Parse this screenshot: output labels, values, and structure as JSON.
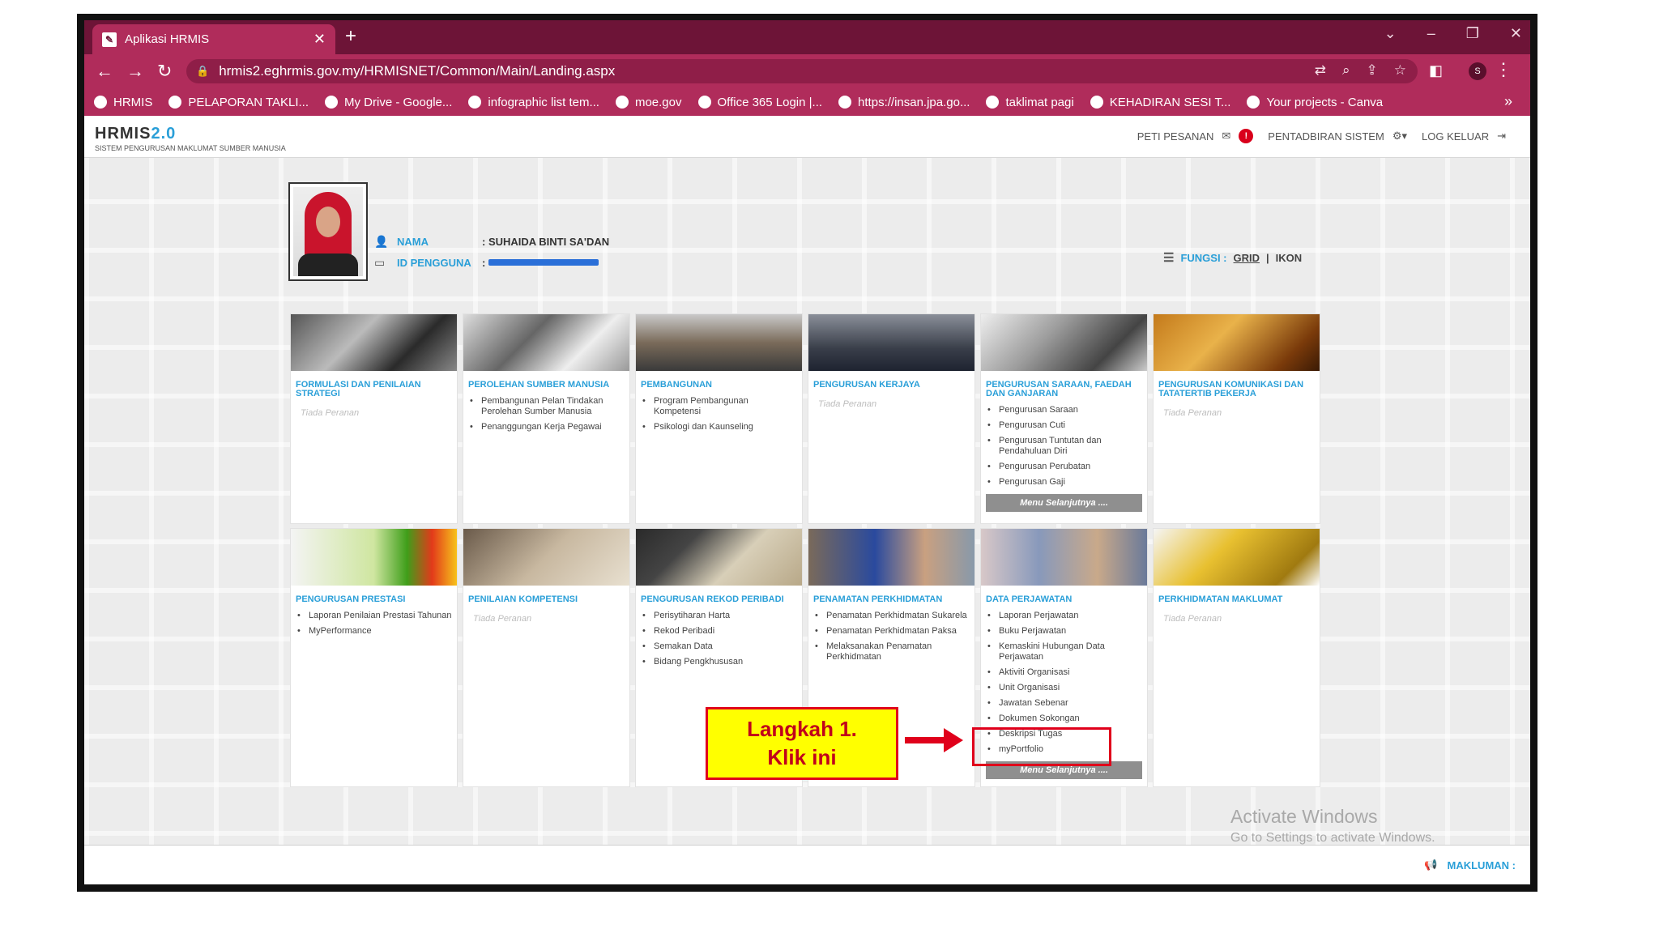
{
  "browser": {
    "tab_title": "Aplikasi HRMIS",
    "url": "hrmis2.eghrmis.gov.my/HRMISNET/Common/Main/Landing.aspx",
    "profile_initial": "S",
    "bookmarks": [
      "HRMIS",
      "PELAPORAN TAKLI...",
      "My Drive - Google...",
      "infographic list tem...",
      "moe.gov",
      "Office 365 Login |...",
      "https://insan.jpa.go...",
      "taklimat pagi",
      "KEHADIRAN SESI T...",
      "Your projects - Canva"
    ]
  },
  "app": {
    "logo_main": "HRMIS",
    "logo_version": "2.0",
    "logo_sub": "SISTEM PENGURUSAN MAKLUMAT SUMBER MANUSIA",
    "header": {
      "messages": "PETI PESANAN",
      "message_badge": "!",
      "admin": "PENTADBIRAN SISTEM",
      "logout": "LOG KELUAR"
    },
    "user": {
      "name_label": "NAMA",
      "name_value": ": SUHAIDA BINTI SA'DAN",
      "id_label": "ID PENGGUNA",
      "id_sep": ":"
    },
    "view": {
      "label": "FUNGSI :",
      "grid": "GRID",
      "sep": "|",
      "icon": "IKON"
    },
    "no_role": "Tiada Peranan",
    "cards": [
      {
        "title": "FORMULASI DAN PENILAIAN STRATEGI",
        "items": []
      },
      {
        "title": "PEROLEHAN SUMBER MANUSIA",
        "items": [
          "Pembangunan Pelan Tindakan Perolehan Sumber Manusia",
          "Penanggungan Kerja Pegawai"
        ]
      },
      {
        "title": "PEMBANGUNAN",
        "items": [
          "Program Pembangunan Kompetensi",
          "Psikologi dan Kaunseling"
        ]
      },
      {
        "title": "PENGURUSAN KERJAYA",
        "items": []
      },
      {
        "title": "PENGURUSAN SARAAN, FAEDAH DAN GANJARAN",
        "items": [
          "Pengurusan Saraan",
          "Pengurusan Cuti",
          "Pengurusan Tuntutan dan Pendahuluan Diri",
          "Pengurusan Perubatan",
          "Pengurusan Gaji"
        ],
        "more": "Menu Selanjutnya ...."
      },
      {
        "title": "PENGURUSAN KOMUNIKASI DAN TATATERTIB PEKERJA",
        "items": []
      },
      {
        "title": "PENGURUSAN PRESTASI",
        "items": [
          "Laporan Penilaian Prestasi Tahunan",
          "MyPerformance"
        ]
      },
      {
        "title": "PENILAIAN KOMPETENSI",
        "items": []
      },
      {
        "title": "PENGURUSAN REKOD PERIBADI",
        "items": [
          "Perisytiharan Harta",
          "Rekod Peribadi",
          "Semakan Data",
          "Bidang Pengkhususan"
        ]
      },
      {
        "title": "PENAMATAN PERKHIDMATAN",
        "items": [
          "Penamatan Perkhidmatan Sukarela",
          "Penamatan Perkhidmatan Paksa",
          "Melaksanakan Penamatan Perkhidmatan"
        ]
      },
      {
        "title": "DATA PERJAWATAN",
        "items": [
          "Laporan Perjawatan",
          "Buku Perjawatan",
          "Kemaskini Hubungan Data Perjawatan",
          "Aktiviti Organisasi",
          "Unit Organisasi",
          "Jawatan Sebenar",
          "Dokumen Sokongan",
          "Deskripsi Tugas",
          "myPortfolio"
        ],
        "more": "Menu Selanjutnya ...."
      },
      {
        "title": "PERKHIDMATAN MAKLUMAT",
        "items": []
      }
    ],
    "callout_line1": "Langkah 1.",
    "callout_line2": "Klik ini",
    "watermark_1": "Activate Windows",
    "watermark_2": "Go to Settings to activate Windows.",
    "footer": "MAKLUMAN :"
  }
}
